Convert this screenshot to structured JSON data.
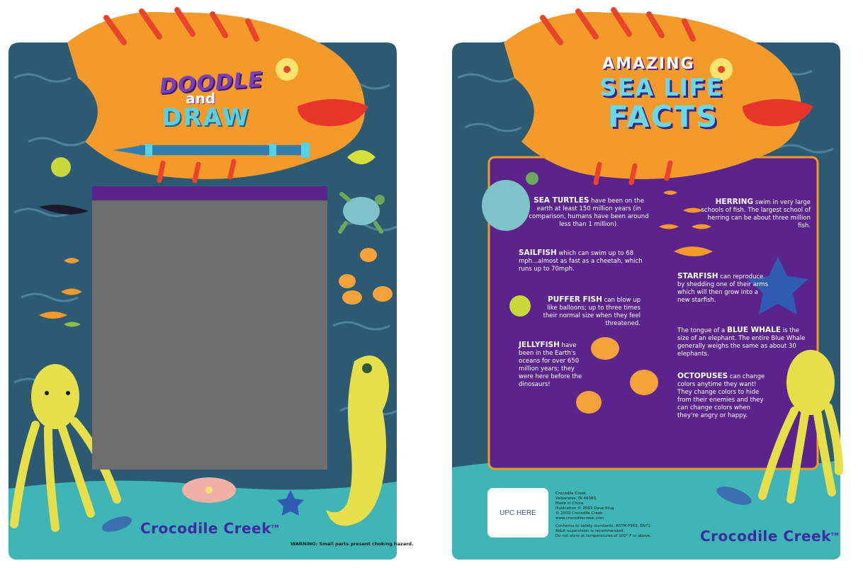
{
  "front": {
    "title_line1": "DOODLE",
    "title_line2": "and",
    "title_line3": "DRAW",
    "brand": "Crocodile Creek",
    "brand_tm": "TM",
    "warning": "WARNING: Small parts present choking hazard."
  },
  "back": {
    "title_line1": "AMAZING",
    "title_line2": "SEA LIFE",
    "title_line3": "FACTS",
    "facts": {
      "sea_turtles": {
        "heading": "SEA TURTLES",
        "text": " have been on the earth at least 150 million years (in comparison, humans have been around less than 1 million)."
      },
      "herring": {
        "heading": "HERRING",
        "text": " swim in very large schools of fish. The largest school of herring can be about three million fish."
      },
      "sailfish": {
        "heading": "SAILFISH",
        "text": " which can swim up to 68 mph...almost as fast as a cheetah, which runs up to 70mph."
      },
      "starfish": {
        "heading": "STARFISH",
        "text": " can reproduce by shedding one of their arms which will then grow into a new starfish."
      },
      "puffer_fish": {
        "heading": "PUFFER FISH",
        "text": " can blow up like balloons; up to three times their normal size when they feel threatened."
      },
      "blue_whale": {
        "prefix": "The tongue of a ",
        "heading": "BLUE WHALE",
        "text": " is the size of an elephant. The entire Blue Whale generally weighs the same as about 30 elephants."
      },
      "jellyfish": {
        "heading": "JELLYFISH",
        "text": " have been in the Earth's oceans for over 650 million years; they were here before the dinosaurs!"
      },
      "octopuses": {
        "heading": "OCTOPUSES",
        "text": " can change colors anytime they want! They change colors to hide from their enemies and they can change colors when they're angry or happy."
      }
    },
    "upc": "UPC HERE",
    "legal": {
      "line1": "Crocodile Creek",
      "line2": "Valparaiso, IN 46383",
      "line3": "Made in China",
      "line4": "Illustration © 2003 Dave Klug",
      "line5": "© 2003 Crocodile Creek",
      "line6": "www.crocodilecreek.com",
      "line7": "Conforms to safety standards: ASTM F963, EN71",
      "line8": "Adult supervision is recommended.",
      "line9": "Do not store at temperatures of 100° F or above."
    },
    "brand": "Crocodile Creek",
    "brand_tm": "TM"
  },
  "colors": {
    "ocean": "#2b5a72",
    "sea_floor": "#3fb5b8",
    "fish_orange": "#f39a2a",
    "fish_stripe": "#e8452b",
    "lips": "#e8352b",
    "facts_panel": "#5b238c",
    "screen": "#6e6e6e",
    "brand": "#3d2ba0"
  }
}
